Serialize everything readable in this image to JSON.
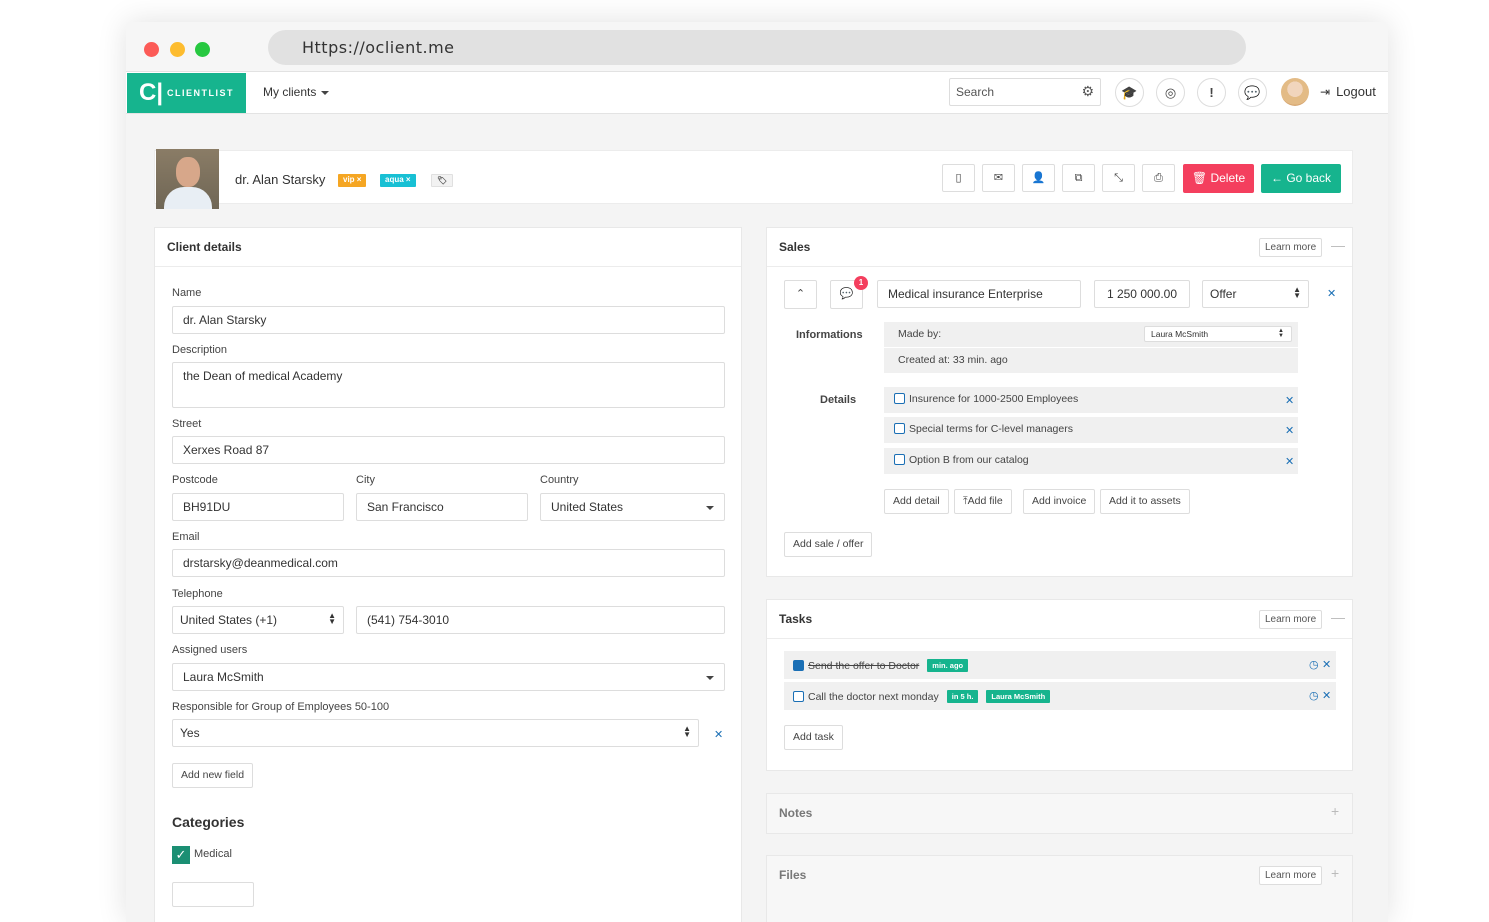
{
  "browser": {
    "url": "Https://oclient.me"
  },
  "navbar": {
    "logo_mark": "C|",
    "logo_text": "CLIENTLIST",
    "menu_label": "My clients",
    "search_placeholder": "Search",
    "logout_label": "Logout"
  },
  "client": {
    "name": "dr. Alan Starsky",
    "tags": [
      "vip ×",
      "aqua ×"
    ],
    "delete_label": "Delete",
    "back_label": "Go back"
  },
  "client_details": {
    "title": "Client details",
    "name_label": "Name",
    "name_value": "dr. Alan Starsky",
    "description_label": "Description",
    "description_value": "the Dean of medical Academy",
    "street_label": "Street",
    "street_value": "Xerxes Road 87",
    "postcode_label": "Postcode",
    "postcode_value": "BH91DU",
    "city_label": "City",
    "city_value": "San Francisco",
    "country_label": "Country",
    "country_value": "United States",
    "email_label": "Email",
    "email_value": "drstarsky@deanmedical.com",
    "telephone_label": "Telephone",
    "phone_country": "United States (+1)",
    "phone_value": "(541) 754-3010",
    "assigned_label": "Assigned users",
    "assigned_value": "Laura McSmith",
    "responsible_label": "Responsible for Group of Employees 50-100",
    "responsible_value": "Yes",
    "add_field_label": "Add new field",
    "categories_title": "Categories",
    "category_medical": "Medical"
  },
  "sales": {
    "title": "Sales",
    "learn_more": "Learn more",
    "comment_count": "1",
    "sale_name": "Medical insurance Enterprise",
    "sale_amount": "1 250 000.00",
    "sale_stage": "Offer",
    "informations_label": "Informations",
    "made_by_label": "Made by:",
    "made_by_value": "Laura McSmith",
    "created_at": "Created at: 33 min. ago",
    "details_label": "Details",
    "details": [
      "Insurence for 1000-2500 Employees",
      "Special terms for C-level managers",
      "Option B from our catalog"
    ],
    "add_detail": "Add detail",
    "add_file": "Add file",
    "add_invoice": "Add invoice",
    "add_assets": "Add it to assets",
    "add_sale": "Add sale / offer"
  },
  "tasks": {
    "title": "Tasks",
    "learn_more": "Learn more",
    "task1_text": "Send the offer to Doctor",
    "task1_badge": "min. ago",
    "task2_text": "Call the doctor next monday",
    "task2_badge": "in 5 h.",
    "task2_user": "Laura McSmith",
    "add_task": "Add task"
  },
  "notes": {
    "title": "Notes"
  },
  "files": {
    "title": "Files",
    "learn_more": "Learn more"
  },
  "colors": {
    "brand": "#16b48e",
    "danger": "#f43f5e",
    "link": "#1a6fb5"
  }
}
